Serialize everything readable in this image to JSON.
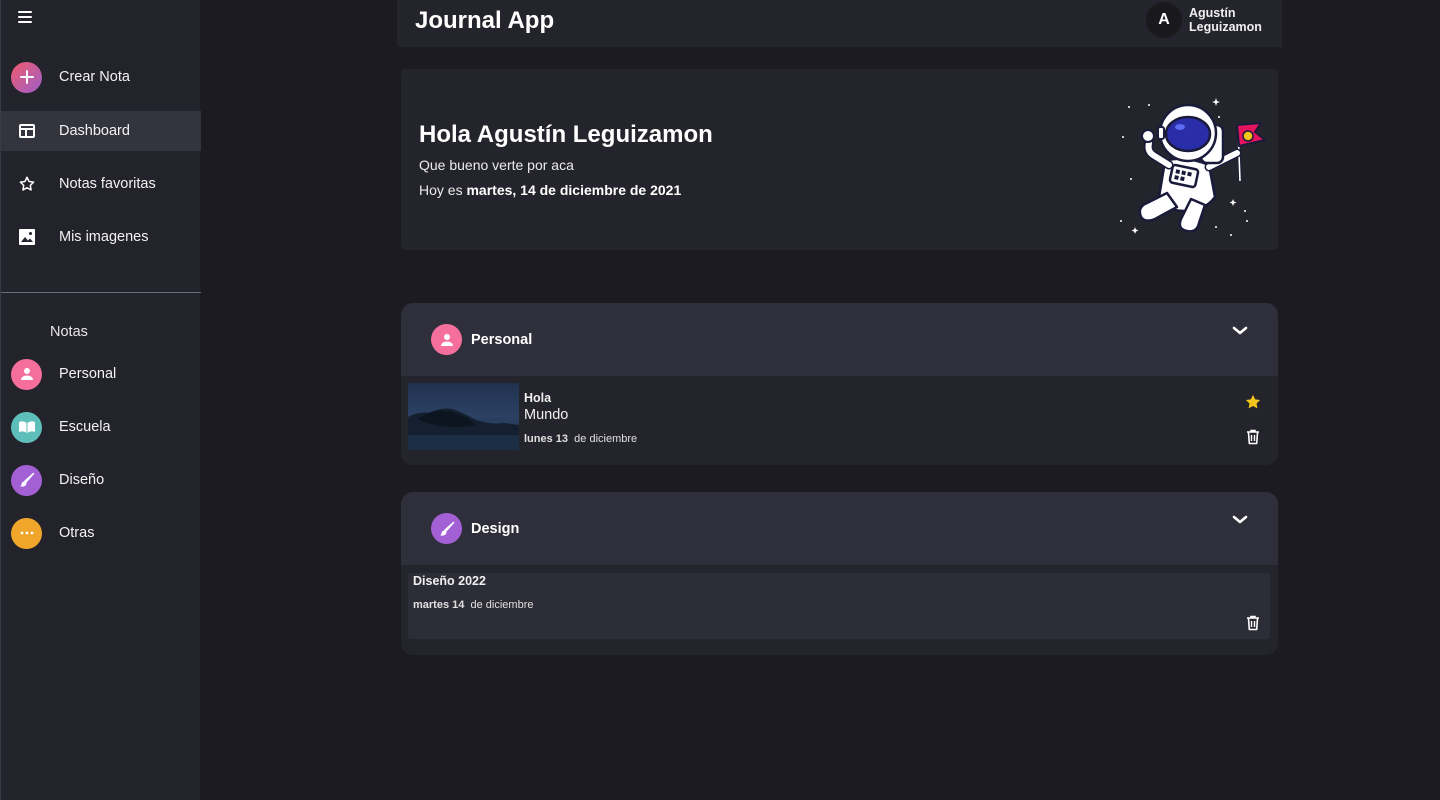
{
  "sidebar": {
    "items": [
      {
        "label": "Crear Nota",
        "icon": "plus-icon"
      },
      {
        "label": "Dashboard",
        "icon": "dashboard-icon"
      },
      {
        "label": "Notas favoritas",
        "icon": "star-outline-icon"
      },
      {
        "label": "Mis imagenes",
        "icon": "image-icon"
      }
    ],
    "section_title": "Notas",
    "categories": [
      {
        "label": "Personal",
        "icon": "person-icon",
        "color": "#f46f9b"
      },
      {
        "label": "Escuela",
        "icon": "book-icon",
        "color": "#5ebfba"
      },
      {
        "label": "Diseño",
        "icon": "brush-icon",
        "color": "#a35fd4"
      },
      {
        "label": "Otras",
        "icon": "more-icon",
        "color": "#f0a62a"
      }
    ]
  },
  "header": {
    "title": "Journal App",
    "avatar_initial": "A",
    "user_first": "Agustín",
    "user_last": "Leguizamon"
  },
  "welcome": {
    "greeting": "Hola Agustín Leguizamon",
    "subtitle": "Que bueno verte por aca",
    "today_prefix": "Hoy es",
    "today_date": "martes, 14 de diciembre de 2021"
  },
  "categories": [
    {
      "title": "Personal",
      "icon": "person-icon",
      "color": "#f46f9b",
      "notes": [
        {
          "title": "Hola",
          "body": "Mundo",
          "date_day": "lunes 13",
          "date_rest": "de diciembre",
          "favorite": true
        }
      ]
    },
    {
      "title": "Design",
      "icon": "brush-icon",
      "color": "#a35fd4",
      "notes": [
        {
          "title": "Diseño 2022",
          "body": "",
          "date_day": "martes 14",
          "date_rest": "de diciembre",
          "favorite": false
        }
      ]
    }
  ],
  "colors": {
    "background": "#1b1b21",
    "surface": "#24242c",
    "surface_header": "#2f2f3b",
    "favorite_star": "#f4c51c",
    "crear_gradient": [
      "#f05a6e",
      "#9b5fc9"
    ]
  }
}
